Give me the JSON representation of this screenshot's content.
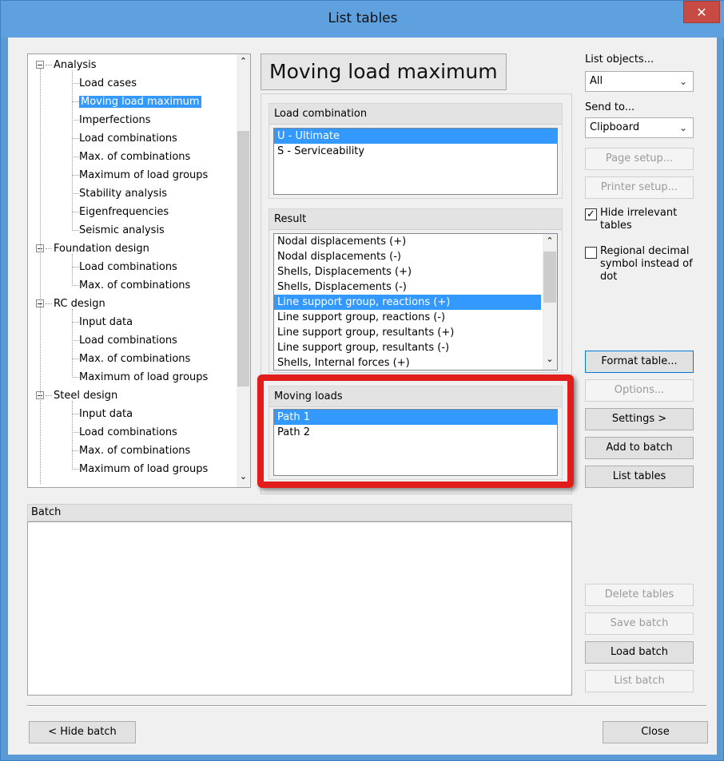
{
  "window": {
    "title": "List tables",
    "close_glyph": "✕"
  },
  "tree": {
    "items": [
      {
        "label": "Analysis",
        "level": 0,
        "expanded": true
      },
      {
        "label": "Load cases",
        "level": 1
      },
      {
        "label": "Moving load maximum",
        "level": 1,
        "selected": true
      },
      {
        "label": "Imperfections",
        "level": 1
      },
      {
        "label": "Load combinations",
        "level": 1
      },
      {
        "label": "Max. of combinations",
        "level": 1
      },
      {
        "label": "Maximum of load groups",
        "level": 1
      },
      {
        "label": "Stability analysis",
        "level": 1
      },
      {
        "label": "Eigenfrequencies",
        "level": 1
      },
      {
        "label": "Seismic analysis",
        "level": 1
      },
      {
        "label": "Foundation design",
        "level": 0,
        "expanded": true
      },
      {
        "label": "Load combinations",
        "level": 1
      },
      {
        "label": "Max. of combinations",
        "level": 1
      },
      {
        "label": "RC design",
        "level": 0,
        "expanded": true
      },
      {
        "label": "Input data",
        "level": 1
      },
      {
        "label": "Load combinations",
        "level": 1
      },
      {
        "label": "Max. of combinations",
        "level": 1
      },
      {
        "label": "Maximum of load groups",
        "level": 1
      },
      {
        "label": "Steel design",
        "level": 0,
        "expanded": true
      },
      {
        "label": "Input data",
        "level": 1
      },
      {
        "label": "Load combinations",
        "level": 1
      },
      {
        "label": "Max. of combinations",
        "level": 1
      },
      {
        "label": "Maximum of load groups",
        "level": 1
      }
    ]
  },
  "main": {
    "heading": "Moving load maximum",
    "load_combination": {
      "title": "Load combination",
      "items": [
        "U - Ultimate",
        "S - Serviceability"
      ],
      "selected_index": 0
    },
    "result": {
      "title": "Result",
      "items": [
        "Nodal displacements (+)",
        "Nodal displacements (-)",
        "Shells, Displacements (+)",
        "Shells, Displacements (-)",
        "Line support group, reactions (+)",
        "Line support group, reactions (-)",
        "Line support group, resultants (+)",
        "Line support group, resultants (-)",
        "Shells, Internal forces (+)"
      ],
      "selected_index": 4
    },
    "moving_loads": {
      "title": "Moving loads",
      "items": [
        "Path 1",
        "Path 2"
      ],
      "selected_index": 0
    }
  },
  "right": {
    "list_objects_label": "List objects...",
    "list_objects_value": "All",
    "send_to_label": "Send to...",
    "send_to_value": "Clipboard",
    "page_setup": "Page setup...",
    "printer_setup": "Printer setup...",
    "hide_irrelevant": "Hide irrelevant tables",
    "hide_irrelevant_checked": true,
    "regional_decimal": "Regional decimal symbol instead of dot",
    "regional_decimal_checked": false,
    "format_table": "Format table...",
    "options": "Options...",
    "settings": "Settings >",
    "add_to_batch": "Add to batch",
    "list_tables": "List tables"
  },
  "batch": {
    "title": "Batch",
    "delete_tables": "Delete tables",
    "save_batch": "Save batch",
    "load_batch": "Load batch",
    "list_batch": "List batch"
  },
  "footer": {
    "hide_batch": "< Hide batch",
    "close": "Close"
  },
  "icons": {
    "combo_arrow": "chevron-down-icon",
    "scroll_up": "chevron-up-icon",
    "scroll_down": "chevron-down-icon",
    "checkmark": "checkmark-icon"
  },
  "colors": {
    "title_bar": "#5ea1de",
    "selection": "#3399ff",
    "highlight_border": "#e21b1b",
    "close_button": "#c74a43"
  }
}
